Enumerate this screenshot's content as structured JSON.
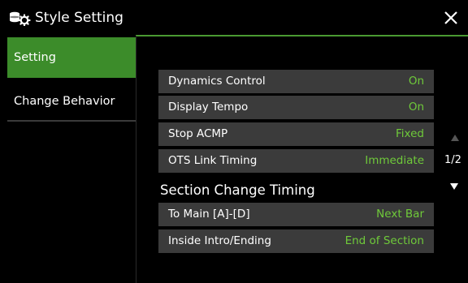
{
  "header": {
    "title": "Style Setting",
    "icon": "style-setting-icon",
    "close_icon": "close-icon"
  },
  "sidebar": {
    "tabs": [
      {
        "label": "Setting",
        "active": true
      },
      {
        "label": "Change Behavior",
        "active": false
      }
    ]
  },
  "settings": [
    {
      "label": "Dynamics Control",
      "value": "On"
    },
    {
      "label": "Display Tempo",
      "value": "On"
    },
    {
      "label": "Stop ACMP",
      "value": "Fixed"
    },
    {
      "label": "OTS Link Timing",
      "value": "Immediate"
    }
  ],
  "section_change": {
    "heading": "Section Change Timing",
    "items": [
      {
        "label": "To Main [A]-[D]",
        "value": "Next Bar"
      },
      {
        "label": "Inside Intro/Ending",
        "value": "End of Section"
      }
    ]
  },
  "pager": {
    "page": "1/2"
  },
  "colors": {
    "accent_green": "#3c8c2a",
    "value_green": "#6fca3a",
    "row_bg": "#3b3b3b",
    "background": "#000000"
  }
}
